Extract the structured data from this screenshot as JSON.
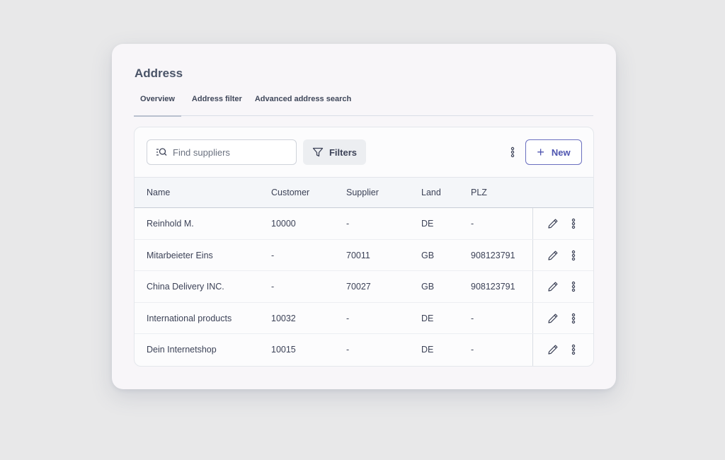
{
  "page": {
    "title": "Address"
  },
  "tabs": [
    {
      "label": "Overview",
      "active": true
    },
    {
      "label": "Address filter",
      "active": false
    },
    {
      "label": "Advanced address search",
      "active": false
    }
  ],
  "toolbar": {
    "search_placeholder": "Find suppliers",
    "search_icon": "search-list-icon",
    "filters_label": "Filters",
    "filters_icon": "funnel-icon",
    "more_icon": "vertical-dots-icon",
    "new_label": "New",
    "new_icon": "plus-icon"
  },
  "table": {
    "columns": [
      "Name",
      "Customer",
      "Supplier",
      "Land",
      "PLZ"
    ],
    "rows": [
      {
        "name": "Reinhold M.",
        "customer": "10000",
        "supplier": "-",
        "land": "DE",
        "plz": "-"
      },
      {
        "name": "Mitarbeieter Eins",
        "customer": "-",
        "supplier": "70011",
        "land": "GB",
        "plz": "908123791"
      },
      {
        "name": "China Delivery INC.",
        "customer": "-",
        "supplier": "70027",
        "land": "GB",
        "plz": "908123791"
      },
      {
        "name": "International products",
        "customer": "10032",
        "supplier": "-",
        "land": "DE",
        "plz": "-"
      },
      {
        "name": "Dein Internetshop",
        "customer": "10015",
        "supplier": "-",
        "land": "DE",
        "plz": "-"
      }
    ],
    "row_action_icons": [
      "pencil-icon",
      "vertical-dots-icon"
    ]
  },
  "colors": {
    "accent": "#4f55b0",
    "window_bg": "#f8f6f9",
    "page_bg": "#e8e8e9",
    "header_bg": "#f4f6f9"
  }
}
